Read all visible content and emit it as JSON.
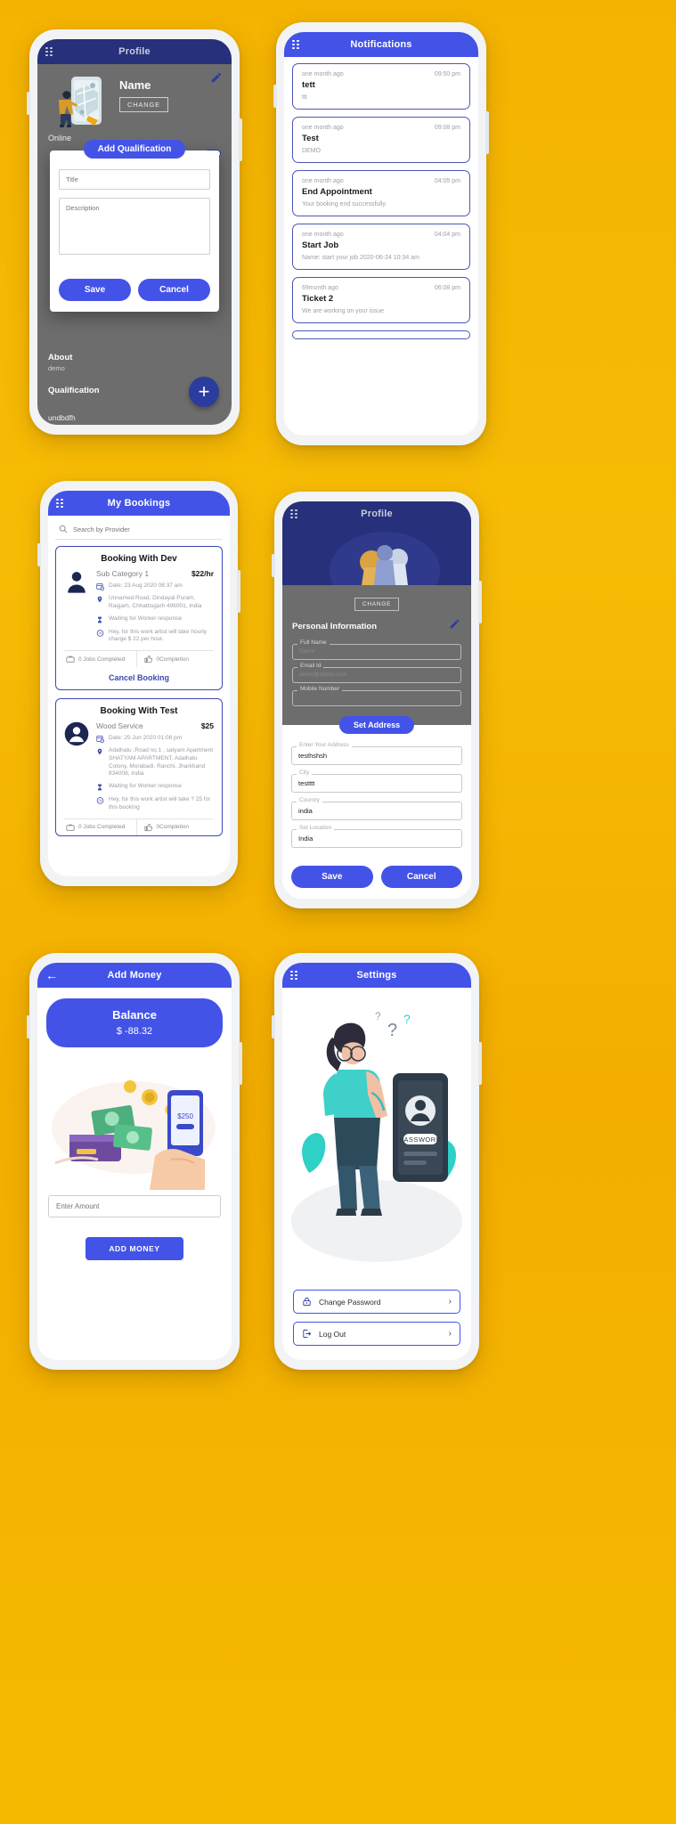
{
  "theme": {
    "page_bg": "#F5B400",
    "primary": "#4353E8",
    "dark_primary": "#27307A",
    "muted": "#9A9CA6"
  },
  "phone1": {
    "appbar": {
      "title": "Profile",
      "menu_icon": "hamburger-icon"
    },
    "profile": {
      "name": "Name",
      "change_label": "CHANGE",
      "status": "Online",
      "edit_icon": "pencil-icon",
      "about_label": "About",
      "about_value": "demo",
      "qualification_label": "Qualification",
      "qualification_value": "undbdfh",
      "fab_icon": "plus-icon"
    },
    "dialog": {
      "title": "Add Qualification",
      "title_placeholder": "Title",
      "title_value": "",
      "description_placeholder": "Description",
      "description_value": "",
      "save_label": "Save",
      "cancel_label": "Cancel"
    }
  },
  "phone2": {
    "appbar": {
      "title": "Notifications",
      "menu_icon": "hamburger-icon"
    },
    "notifications": [
      {
        "ago": "one month ago",
        "time": "09:50 pm",
        "title": "tett",
        "body": "ttt"
      },
      {
        "ago": "one month ago",
        "time": "09:08 pm",
        "title": "Test",
        "body": "DEMO"
      },
      {
        "ago": "one month ago",
        "time": "04:05 pm",
        "title": "End Appointment",
        "body": "Your booking end successfully."
      },
      {
        "ago": "one month ago",
        "time": "04:04 pm",
        "title": "Start Job",
        "body": "Name: start your job 2020-06-24 10:34 am"
      },
      {
        "ago": "69month ago",
        "time": "06:08 pm",
        "title": "Ticket 2",
        "body": "We are working on your issue"
      }
    ]
  },
  "phone3": {
    "appbar": {
      "title": "My Bookings",
      "menu_icon": "hamburger-icon"
    },
    "search": {
      "placeholder": "Search by Provider",
      "value": "",
      "icon": "search-icon"
    },
    "bookings": [
      {
        "title": "Booking With Dev",
        "subcategory": "Sub Category 1",
        "price": "$22/hr",
        "date": "Date: 23 Aug 2020 08:37 am",
        "address": "Unnamed Road, Dindayal Puram, Raigarh, Chhattisgarh 496001, India",
        "status": "Waiting for Worker response",
        "note": "Hey, for this work artist will take hourly charge $ 22 per hour.",
        "jobs": "0 Jobs Completed",
        "completion": "0Completion",
        "cancel_label": "Cancel Booking",
        "avatar": "person-avatar-icon"
      },
      {
        "title": "Booking With Test",
        "subcategory": "Wood Service",
        "price": "$25",
        "date": "Date: 25 Jun 2020 01:08 pm",
        "address": "Adalhatu ,Road no.1 , satyam Apartment SHATYAM APARTMENT, Adalhatu Colony, Morabadi, Ranchi, Jharkhand 834008, India",
        "status": "Waiting for Worker response",
        "note": "Hey, for this work artist will take ? 25 for this booking",
        "jobs": "0 Jobs Completed",
        "completion": "0Completion",
        "cancel_label": "",
        "avatar": "person-circle-avatar-icon"
      }
    ]
  },
  "phone4": {
    "appbar": {
      "title": "Profile",
      "menu_icon": "hamburger-icon"
    },
    "change_label": "CHANGE",
    "personal_info_label": "Personal Information",
    "edit_icon": "pencil-icon",
    "fields": [
      {
        "label": "Full Name",
        "value": "Demo"
      },
      {
        "label": "Email Id",
        "value": "demo@demo.com"
      },
      {
        "label": "Mobile Number",
        "value": ""
      }
    ],
    "sheet": {
      "title": "Set Address",
      "fields": [
        {
          "label": "Enter Your Address",
          "value": "testhshsh"
        },
        {
          "label": "City",
          "value": "testttt"
        },
        {
          "label": "Country",
          "value": "india"
        },
        {
          "label": "Set Location",
          "value": "India"
        }
      ]
    },
    "save_label": "Save",
    "cancel_label": "Cancel"
  },
  "phone5": {
    "appbar": {
      "title": "Add Money",
      "back_icon": "arrow-left-icon"
    },
    "balance_label": "Balance",
    "balance_value": "$ -88.32",
    "amount_placeholder": "Enter Amount",
    "amount_value": "",
    "add_money_label": "ADD MONEY",
    "illustration": "money-phone-payment-illustration"
  },
  "phone6": {
    "appbar": {
      "title": "Settings",
      "menu_icon": "hamburger-icon"
    },
    "illustration": "forgot-password-woman-illustration",
    "rows": [
      {
        "label": "Change Password",
        "icon": "lock-icon",
        "chevron": "chevron-right-icon"
      },
      {
        "label": "Log Out",
        "icon": "logout-icon",
        "chevron": "chevron-right-icon"
      }
    ]
  }
}
